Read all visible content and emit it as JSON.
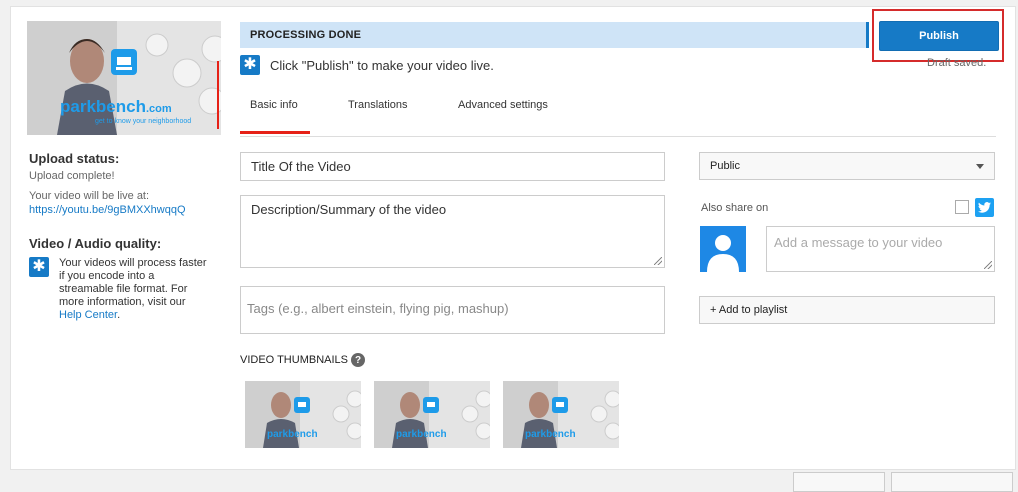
{
  "processing": {
    "status": "PROCESSING DONE",
    "hint": "Click \"Publish\" to make your video live."
  },
  "publish": {
    "label": "Publish",
    "draft_status": "Draft saved."
  },
  "thumbnail": {
    "brand": "parkbench",
    "brand_suffix": ".com",
    "tagline": "get to know your neighborhood"
  },
  "upload": {
    "status_heading": "Upload status:",
    "status_text": "Upload complete!",
    "live_at_label": "Your video will be live at:",
    "url": "https://youtu.be/9gBMXXhwqqQ"
  },
  "quality": {
    "heading": "Video / Audio quality:",
    "text": "Your videos will process faster if you encode into a streamable file format. For more information, visit our",
    "link": "Help Center",
    "trailing": "."
  },
  "tabs": [
    {
      "label": "Basic info",
      "active": true
    },
    {
      "label": "Translations",
      "active": false
    },
    {
      "label": "Advanced settings",
      "active": false
    }
  ],
  "form": {
    "title_value": "Title Of the Video",
    "description_value": "Description/Summary of the video",
    "tags_placeholder": "Tags (e.g., albert einstein, flying pig, mashup)"
  },
  "privacy": {
    "selected": "Public"
  },
  "share": {
    "label": "Also share on",
    "message_placeholder": "Add a message to your video"
  },
  "playlist": {
    "label": "+ Add to playlist"
  },
  "thumbnails": {
    "label": "VIDEO THUMBNAILS",
    "help_glyph": "?"
  },
  "colors": {
    "accent": "#167ac6",
    "red": "#e62117",
    "twitter": "#1da1f2",
    "processing_bg": "#cfe4f7"
  },
  "icons": [
    "star-badge-icon",
    "twitter-icon",
    "help-icon",
    "dropdown-caret-icon",
    "resize-handle-icon",
    "avatar-icon"
  ]
}
